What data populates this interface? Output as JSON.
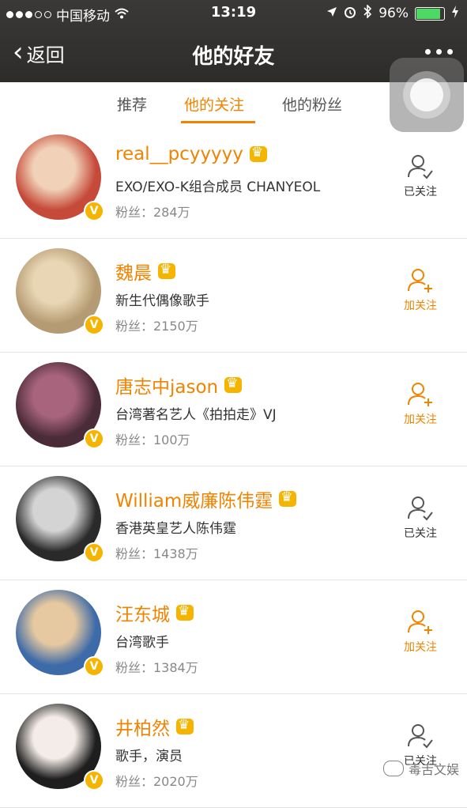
{
  "status": {
    "carrier": "中国移动",
    "time": "13:19",
    "battery": "96%",
    "battery_fraction": 0.96
  },
  "nav": {
    "back_label": "返回",
    "title": "他的好友"
  },
  "tabs": [
    {
      "label": "推荐",
      "active": false
    },
    {
      "label": "他的关注",
      "active": true
    },
    {
      "label": "他的粉丝",
      "active": false
    }
  ],
  "users": [
    {
      "name": "real__pcyyyyy",
      "desc": "EXO/EXO-K组合成员 CHANYEOL",
      "fans": "粉丝：284万",
      "follow_label": "已关注",
      "followed": true,
      "avatar_colors": [
        "#c64a3a",
        "#f1d2b8"
      ]
    },
    {
      "name": "魏晨",
      "desc": "新生代偶像歌手",
      "fans": "粉丝：2150万",
      "follow_label": "加关注",
      "followed": false,
      "avatar_colors": [
        "#b59b73",
        "#e8d6b4"
      ]
    },
    {
      "name": "唐志中jason",
      "desc": "台湾著名艺人《拍拍走》VJ",
      "fans": "粉丝：100万",
      "follow_label": "加关注",
      "followed": false,
      "avatar_colors": [
        "#4a2b38",
        "#a8647c"
      ]
    },
    {
      "name": "William威廉陈伟霆",
      "desc": "香港英皇艺人陈伟霆",
      "fans": "粉丝：1438万",
      "follow_label": "已关注",
      "followed": true,
      "avatar_colors": [
        "#2a2a2a",
        "#d4d4d4"
      ]
    },
    {
      "name": "汪东城",
      "desc": "台湾歌手",
      "fans": "粉丝：1384万",
      "follow_label": "加关注",
      "followed": false,
      "avatar_colors": [
        "#3d6aa8",
        "#e6c9a0"
      ]
    },
    {
      "name": "井柏然",
      "desc": "歌手，演员",
      "fans": "粉丝：2020万",
      "follow_label": "已关注",
      "followed": true,
      "avatar_colors": [
        "#1e1e1e",
        "#f4ece8"
      ]
    }
  ],
  "watermark": "毒舌文娱",
  "colors": {
    "accent": "#f08300",
    "verified": "#f5b400",
    "topbar": "#34322f"
  }
}
